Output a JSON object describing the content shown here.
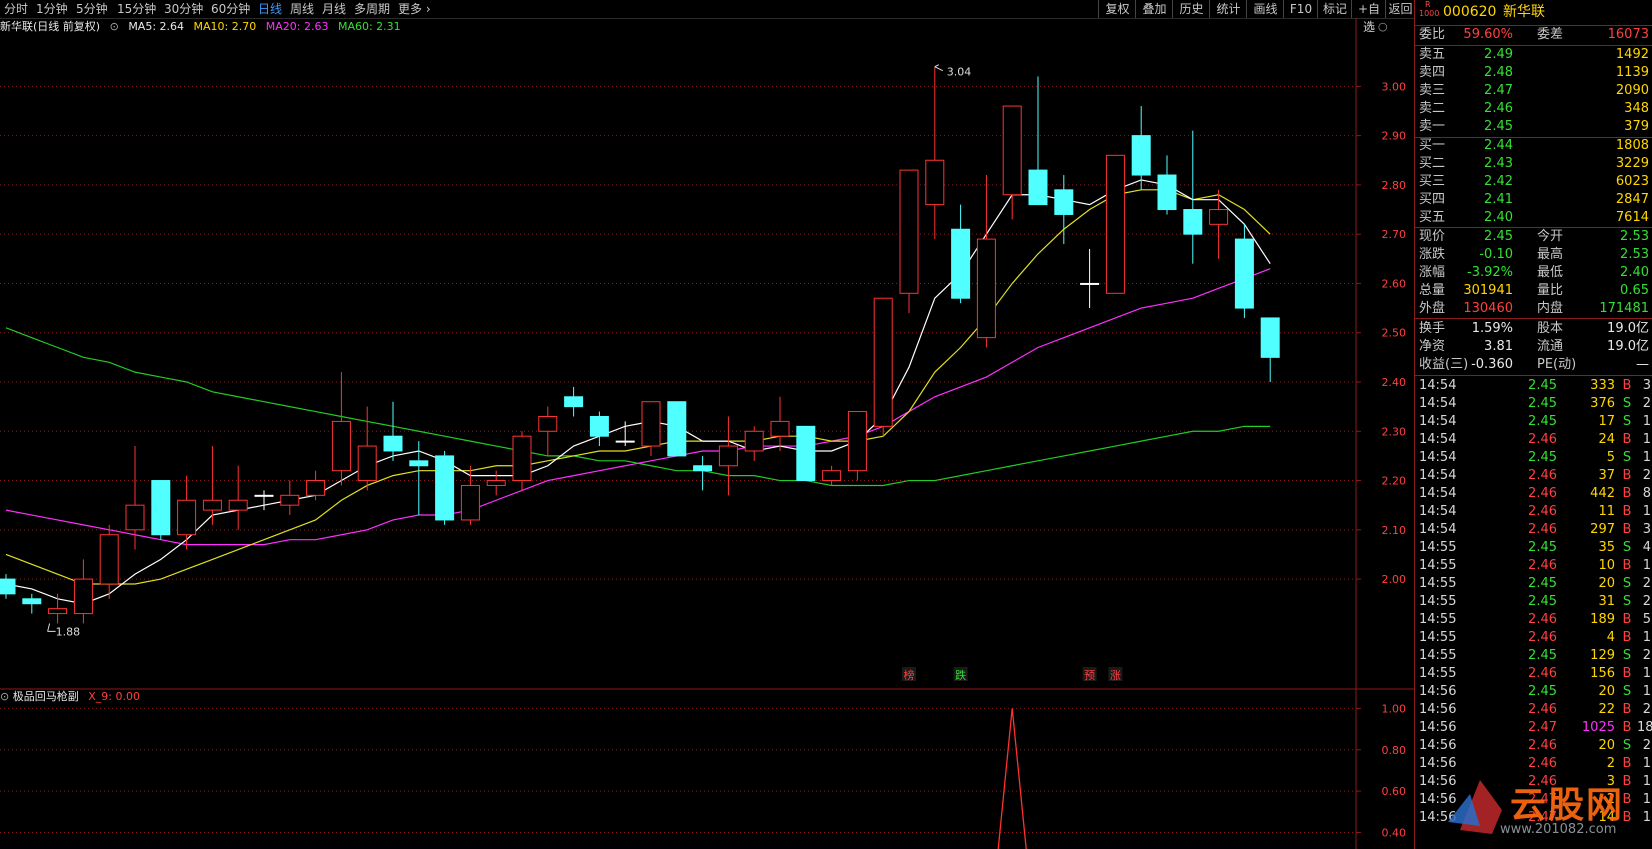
{
  "toolbar": {
    "periods": [
      "分时",
      "1分钟",
      "5分钟",
      "15分钟",
      "30分钟",
      "60分钟",
      "日线",
      "周线",
      "月线",
      "多周期",
      "更多"
    ],
    "active": "日线",
    "right": [
      "复权",
      "叠加",
      "历史",
      "统计",
      "画线",
      "F10",
      "标记",
      "+自选",
      "返回"
    ]
  },
  "ma_header": {
    "title": "新华联(日线 前复权)",
    "ma5": "MA5: 2.64",
    "ma10": "MA10: 2.70",
    "ma20": "MA20: 2.63",
    "ma60": "MA60: 2.31"
  },
  "sub_header": {
    "title": "极品回马枪副",
    "x9": "X_9: 0.00"
  },
  "colors": {
    "up": "#ff3333",
    "down": "#50ffff",
    "ma5": "#ffffff",
    "ma10": "#e0e020",
    "ma20": "#ff30ff",
    "ma60": "#22cc22",
    "grid": "#8b1a1a"
  },
  "chart_data": {
    "type": "candlestick",
    "ylim": [
      1.85,
      3.09
    ],
    "y_ticks": [
      "3.00",
      "2.90",
      "2.80",
      "2.70",
      "2.60",
      "2.50",
      "2.40",
      "2.30",
      "2.20",
      "2.10",
      "2.00"
    ],
    "annotations": {
      "high": "3.04",
      "low": "1.88"
    },
    "signals": [
      {
        "label": "榜",
        "color": "#ff4040",
        "index": 35
      },
      {
        "label": "跌",
        "color": "#33e033",
        "index": 37
      },
      {
        "label": "预",
        "color": "#ff4040",
        "index": 42
      },
      {
        "label": "涨",
        "color": "#ff4040",
        "index": 43
      }
    ],
    "candles": [
      [
        2.0,
        2.01,
        1.96,
        1.97
      ],
      [
        1.96,
        1.97,
        1.93,
        1.95
      ],
      [
        1.93,
        1.97,
        1.91,
        1.94
      ],
      [
        1.93,
        2.04,
        1.91,
        2.0
      ],
      [
        1.99,
        2.11,
        1.96,
        2.09
      ],
      [
        2.1,
        2.27,
        2.06,
        2.15
      ],
      [
        2.2,
        2.2,
        2.08,
        2.09
      ],
      [
        2.09,
        2.21,
        2.06,
        2.16
      ],
      [
        2.14,
        2.27,
        2.11,
        2.16
      ],
      [
        2.14,
        2.23,
        2.1,
        2.16
      ],
      [
        2.17,
        2.18,
        2.14,
        2.17
      ],
      [
        2.15,
        2.2,
        2.13,
        2.17
      ],
      [
        2.17,
        2.22,
        2.16,
        2.2
      ],
      [
        2.22,
        2.42,
        2.19,
        2.32
      ],
      [
        2.2,
        2.35,
        2.18,
        2.27
      ],
      [
        2.29,
        2.36,
        2.24,
        2.26
      ],
      [
        2.24,
        2.28,
        2.13,
        2.23
      ],
      [
        2.25,
        2.26,
        2.11,
        2.12
      ],
      [
        2.12,
        2.23,
        2.11,
        2.19
      ],
      [
        2.19,
        2.22,
        2.17,
        2.2
      ],
      [
        2.2,
        2.3,
        2.18,
        2.29
      ],
      [
        2.3,
        2.35,
        2.25,
        2.33
      ],
      [
        2.37,
        2.39,
        2.33,
        2.35
      ],
      [
        2.33,
        2.34,
        2.27,
        2.29
      ],
      [
        2.28,
        2.32,
        2.27,
        2.28
      ],
      [
        2.27,
        2.36,
        2.25,
        2.36
      ],
      [
        2.36,
        2.36,
        2.25,
        2.25
      ],
      [
        2.23,
        2.25,
        2.18,
        2.22
      ],
      [
        2.23,
        2.33,
        2.17,
        2.27
      ],
      [
        2.26,
        2.31,
        2.24,
        2.3
      ],
      [
        2.29,
        2.37,
        2.26,
        2.32
      ],
      [
        2.31,
        2.31,
        2.2,
        2.2
      ],
      [
        2.2,
        2.23,
        2.19,
        2.22
      ],
      [
        2.22,
        2.34,
        2.2,
        2.34
      ],
      [
        2.31,
        2.57,
        2.29,
        2.57
      ],
      [
        2.58,
        2.83,
        2.54,
        2.83
      ],
      [
        2.76,
        3.04,
        2.69,
        2.85
      ],
      [
        2.71,
        2.76,
        2.56,
        2.57
      ],
      [
        2.49,
        2.82,
        2.47,
        2.69
      ],
      [
        2.78,
        2.96,
        2.73,
        2.96
      ],
      [
        2.83,
        3.02,
        2.76,
        2.76
      ],
      [
        2.79,
        2.82,
        2.68,
        2.74
      ],
      [
        2.6,
        2.67,
        2.55,
        2.6
      ],
      [
        2.58,
        2.86,
        2.58,
        2.86
      ],
      [
        2.9,
        2.96,
        2.79,
        2.82
      ],
      [
        2.82,
        2.86,
        2.74,
        2.75
      ],
      [
        2.75,
        2.91,
        2.64,
        2.7
      ],
      [
        2.72,
        2.79,
        2.65,
        2.75
      ],
      [
        2.69,
        2.72,
        2.53,
        2.55
      ],
      [
        2.53,
        2.53,
        2.4,
        2.45
      ]
    ],
    "ma5": [
      1.99,
      1.98,
      1.96,
      1.95,
      1.97,
      2.01,
      2.04,
      2.08,
      2.13,
      2.14,
      2.15,
      2.16,
      2.17,
      2.2,
      2.23,
      2.25,
      2.26,
      2.24,
      2.21,
      2.21,
      2.21,
      2.23,
      2.27,
      2.29,
      2.31,
      2.32,
      2.31,
      2.28,
      2.28,
      2.26,
      2.27,
      2.26,
      2.26,
      2.28,
      2.33,
      2.43,
      2.57,
      2.62,
      2.7,
      2.78,
      2.78,
      2.77,
      2.76,
      2.79,
      2.81,
      2.8,
      2.77,
      2.77,
      2.72,
      2.64
    ],
    "ma10": [
      2.05,
      2.03,
      2.01,
      1.99,
      1.99,
      1.99,
      2.0,
      2.02,
      2.04,
      2.06,
      2.08,
      2.1,
      2.12,
      2.16,
      2.19,
      2.21,
      2.22,
      2.22,
      2.22,
      2.23,
      2.23,
      2.24,
      2.25,
      2.26,
      2.26,
      2.27,
      2.28,
      2.28,
      2.28,
      2.28,
      2.29,
      2.29,
      2.28,
      2.28,
      2.29,
      2.34,
      2.42,
      2.47,
      2.53,
      2.6,
      2.66,
      2.71,
      2.75,
      2.78,
      2.79,
      2.79,
      2.77,
      2.78,
      2.75,
      2.7
    ],
    "ma20": [
      2.14,
      2.13,
      2.12,
      2.11,
      2.1,
      2.09,
      2.08,
      2.07,
      2.07,
      2.07,
      2.07,
      2.08,
      2.08,
      2.09,
      2.1,
      2.12,
      2.13,
      2.13,
      2.14,
      2.16,
      2.18,
      2.2,
      2.21,
      2.22,
      2.23,
      2.24,
      2.25,
      2.26,
      2.26,
      2.27,
      2.27,
      2.27,
      2.28,
      2.29,
      2.31,
      2.34,
      2.37,
      2.39,
      2.41,
      2.44,
      2.47,
      2.49,
      2.51,
      2.53,
      2.55,
      2.56,
      2.57,
      2.59,
      2.61,
      2.63
    ],
    "ma60": [
      2.51,
      2.49,
      2.47,
      2.45,
      2.44,
      2.42,
      2.41,
      2.4,
      2.38,
      2.37,
      2.36,
      2.35,
      2.34,
      2.33,
      2.32,
      2.31,
      2.3,
      2.29,
      2.28,
      2.27,
      2.26,
      2.25,
      2.25,
      2.24,
      2.24,
      2.23,
      2.22,
      2.22,
      2.21,
      2.21,
      2.2,
      2.2,
      2.19,
      2.19,
      2.19,
      2.2,
      2.2,
      2.21,
      2.22,
      2.23,
      2.24,
      2.25,
      2.26,
      2.27,
      2.28,
      2.29,
      2.3,
      2.3,
      2.31,
      2.31
    ],
    "sub": {
      "ylim": [
        0.32,
        1.06
      ],
      "y_ticks": [
        "1.00",
        "0.80",
        "0.60",
        "0.40"
      ],
      "peak_index": 39,
      "peak_value": 1.0
    }
  },
  "panel": {
    "code": "000620",
    "name": "新华联",
    "badge_top": "R",
    "badge_bottom": "1000",
    "weibi_label": "委比",
    "weibi": "59.60%",
    "weicha_label": "委差",
    "weicha": "16073",
    "asks": [
      {
        "label": "卖五",
        "price": "2.49",
        "vol": "1492"
      },
      {
        "label": "卖四",
        "price": "2.48",
        "vol": "1139"
      },
      {
        "label": "卖三",
        "price": "2.47",
        "vol": "2090"
      },
      {
        "label": "卖二",
        "price": "2.46",
        "vol": "348"
      },
      {
        "label": "卖一",
        "price": "2.45",
        "vol": "379"
      }
    ],
    "bids": [
      {
        "label": "买一",
        "price": "2.44",
        "vol": "1808"
      },
      {
        "label": "买二",
        "price": "2.43",
        "vol": "3229"
      },
      {
        "label": "买三",
        "price": "2.42",
        "vol": "6023"
      },
      {
        "label": "买四",
        "price": "2.41",
        "vol": "2847"
      },
      {
        "label": "买五",
        "price": "2.40",
        "vol": "7614"
      }
    ],
    "quote": [
      {
        "l1": "现价",
        "v1": "2.45",
        "c1": "green",
        "l2": "今开",
        "v2": "2.53",
        "c2": "green"
      },
      {
        "l1": "涨跌",
        "v1": "-0.10",
        "c1": "green",
        "l2": "最高",
        "v2": "2.53",
        "c2": "green"
      },
      {
        "l1": "涨幅",
        "v1": "-3.92%",
        "c1": "green",
        "l2": "最低",
        "v2": "2.40",
        "c2": "green"
      },
      {
        "l1": "总量",
        "v1": "301941",
        "c1": "yellow",
        "l2": "量比",
        "v2": "0.65",
        "c2": "green"
      },
      {
        "l1": "外盘",
        "v1": "130460",
        "c1": "red",
        "l2": "内盘",
        "v2": "171481",
        "c2": "green"
      }
    ],
    "finance": [
      {
        "l1": "换手",
        "v1": "1.59%",
        "l2": "股本",
        "v2": "19.0亿"
      },
      {
        "l1": "净资",
        "v1": "3.81",
        "l2": "流通",
        "v2": "19.0亿"
      },
      {
        "l1": "收益(三)",
        "v1": "-0.360",
        "l2": "PE(动)",
        "v2": "—"
      }
    ],
    "trades": [
      {
        "t": "14:54",
        "p": "2.45",
        "v": "333",
        "d": "B",
        "n": "3"
      },
      {
        "t": "14:54",
        "p": "2.45",
        "v": "376",
        "d": "S",
        "n": "2"
      },
      {
        "t": "14:54",
        "p": "2.45",
        "v": "17",
        "d": "S",
        "n": "1"
      },
      {
        "t": "14:54",
        "p": "2.46",
        "v": "24",
        "d": "B",
        "n": "1"
      },
      {
        "t": "14:54",
        "p": "2.45",
        "v": "5",
        "d": "S",
        "n": "1"
      },
      {
        "t": "14:54",
        "p": "2.46",
        "v": "37",
        "d": "B",
        "n": "2"
      },
      {
        "t": "14:54",
        "p": "2.46",
        "v": "442",
        "d": "B",
        "n": "8"
      },
      {
        "t": "14:54",
        "p": "2.46",
        "v": "11",
        "d": "B",
        "n": "1"
      },
      {
        "t": "14:54",
        "p": "2.46",
        "v": "297",
        "d": "B",
        "n": "3"
      },
      {
        "t": "14:55",
        "p": "2.45",
        "v": "35",
        "d": "S",
        "n": "4"
      },
      {
        "t": "14:55",
        "p": "2.46",
        "v": "10",
        "d": "B",
        "n": "1"
      },
      {
        "t": "14:55",
        "p": "2.45",
        "v": "20",
        "d": "S",
        "n": "2"
      },
      {
        "t": "14:55",
        "p": "2.45",
        "v": "31",
        "d": "S",
        "n": "2"
      },
      {
        "t": "14:55",
        "p": "2.46",
        "v": "189",
        "d": "B",
        "n": "5"
      },
      {
        "t": "14:55",
        "p": "2.46",
        "v": "4",
        "d": "B",
        "n": "1"
      },
      {
        "t": "14:55",
        "p": "2.45",
        "v": "129",
        "d": "S",
        "n": "2"
      },
      {
        "t": "14:55",
        "p": "2.46",
        "v": "156",
        "d": "B",
        "n": "1"
      },
      {
        "t": "14:56",
        "p": "2.45",
        "v": "20",
        "d": "S",
        "n": "1"
      },
      {
        "t": "14:56",
        "p": "2.46",
        "v": "22",
        "d": "B",
        "n": "2"
      },
      {
        "t": "14:56",
        "p": "2.47",
        "v": "1025",
        "d": "B",
        "n": "18"
      },
      {
        "t": "14:56",
        "p": "2.46",
        "v": "20",
        "d": "S",
        "n": "2"
      },
      {
        "t": "14:56",
        "p": "2.46",
        "v": "2",
        "d": "B",
        "n": "1"
      },
      {
        "t": "14:56",
        "p": "2.46",
        "v": "3",
        "d": "B",
        "n": "1"
      },
      {
        "t": "14:56",
        "p": "2.47",
        "v": "2",
        "d": "B",
        "n": "1"
      },
      {
        "t": "14:56",
        "p": "2.47",
        "v": "14",
        "d": "B",
        "n": "1"
      }
    ]
  },
  "watermark": {
    "brand": "云股网",
    "url": "www.201082.com"
  }
}
